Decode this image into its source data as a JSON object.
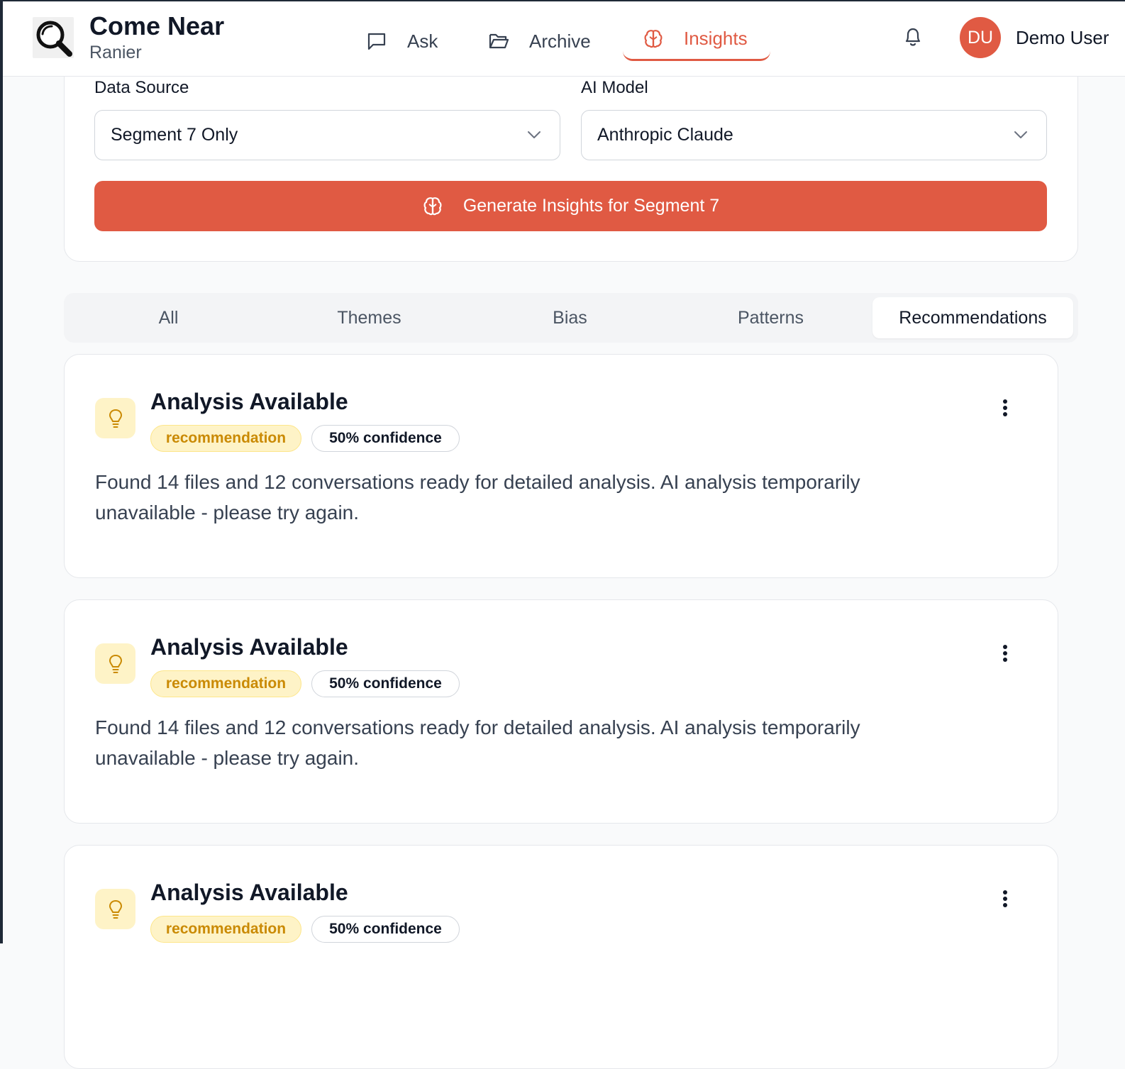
{
  "header": {
    "app_title": "Come Near",
    "app_subtitle": "Ranier",
    "nav": [
      {
        "label": "Ask",
        "icon": "chat-bubble-icon"
      },
      {
        "label": "Archive",
        "icon": "folder-open-icon"
      },
      {
        "label": "Insights",
        "icon": "brain-icon",
        "active": true
      }
    ],
    "user": {
      "initials": "DU",
      "name": "Demo User"
    }
  },
  "config": {
    "data_source_label": "Data Source",
    "data_source_value": "Segment 7 Only",
    "ai_model_label": "AI Model",
    "ai_model_value": "Anthropic Claude",
    "generate_button": "Generate Insights for Segment 7"
  },
  "tabs": [
    {
      "label": "All"
    },
    {
      "label": "Themes"
    },
    {
      "label": "Bias"
    },
    {
      "label": "Patterns"
    },
    {
      "label": "Recommendations",
      "active": true
    }
  ],
  "insights": [
    {
      "title": "Analysis Available",
      "type": "recommendation",
      "confidence": "50% confidence",
      "description": "Found 14 files and 12 conversations ready for detailed analysis. AI analysis temporarily unavailable - please try again."
    },
    {
      "title": "Analysis Available",
      "type": "recommendation",
      "confidence": "50% confidence",
      "description": "Found 14 files and 12 conversations ready for detailed analysis. AI analysis temporarily unavailable - please try again."
    },
    {
      "title": "Analysis Available",
      "type": "recommendation",
      "confidence": "50% confidence",
      "description": ""
    }
  ],
  "colors": {
    "accent": "#e05a43",
    "recommendation_badge_bg": "#fef3c7",
    "recommendation_badge_text": "#ca8a04"
  }
}
